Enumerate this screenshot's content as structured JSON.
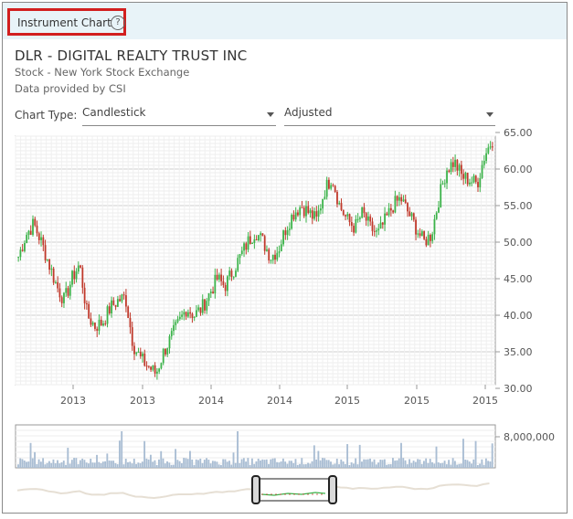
{
  "header": {
    "title": "Instrument Chart",
    "help_icon": "question-circle-icon"
  },
  "instrument": {
    "name": "DLR - DIGITAL REALTY TRUST INC",
    "type_line": "Stock - New York Stock Exchange",
    "source_line": "Data provided by CSI"
  },
  "controls": {
    "chart_type_label": "Chart Type:",
    "chart_type_value": "Candlestick",
    "adjustment_value": "Adjusted"
  },
  "colors": {
    "up": "#3cb34a",
    "down": "#c0392b",
    "volume": "#a9bdd3",
    "grid": "#dcdcdc",
    "highlight": "#d21f1f"
  },
  "chart_data": {
    "type": "candlestick",
    "y_ticks": [
      "65.00",
      "60.00",
      "55.00",
      "50.00",
      "45.00",
      "40.00",
      "35.00",
      "30.00"
    ],
    "x_ticks": [
      "2013",
      "2013",
      "2014",
      "2014",
      "2015",
      "2015",
      "2015"
    ],
    "ylim": [
      30,
      65
    ],
    "volume_tick": "8,000,000",
    "close_series": [
      48,
      51,
      52.5,
      50,
      47,
      44,
      42,
      45,
      47,
      40,
      38.5,
      39,
      41,
      42,
      42.5,
      36,
      34,
      33,
      32,
      35,
      37,
      39,
      41,
      40,
      41,
      43,
      45,
      44,
      46,
      48,
      50,
      51.5,
      50,
      48,
      49,
      52,
      54,
      55,
      54,
      53,
      57,
      59,
      55,
      53,
      52,
      54,
      52,
      51,
      53,
      55,
      56,
      54,
      52,
      50,
      51,
      56,
      60,
      61,
      59,
      58.5,
      58,
      62,
      64
    ]
  }
}
